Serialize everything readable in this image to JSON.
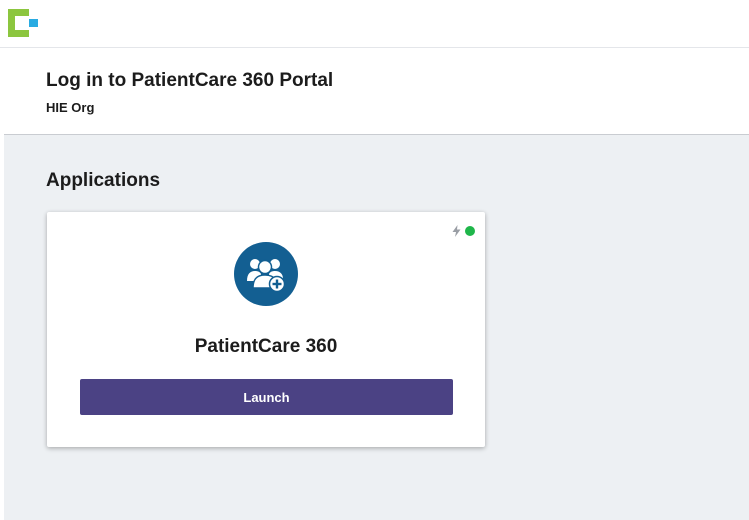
{
  "header": {
    "title": "Log in to PatientCare 360 Portal",
    "org": "HIE Org"
  },
  "applications": {
    "section_title": "Applications",
    "items": [
      {
        "name": "PatientCare 360",
        "launch_label": "Launch",
        "status": "online",
        "icon": "users-plus-icon"
      }
    ]
  },
  "colors": {
    "brand_green": "#8cc63f",
    "brand_blue": "#29abe2",
    "app_icon_bg": "#135f92",
    "launch_button": "#4b4284",
    "status_online": "#1fb64a",
    "page_bg": "#edf0f3"
  }
}
